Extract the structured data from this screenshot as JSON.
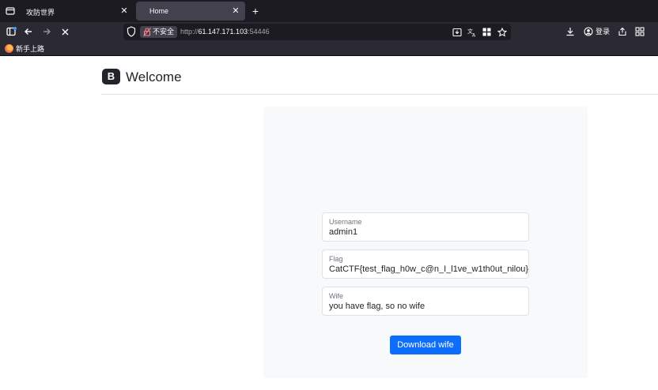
{
  "browser": {
    "tabs": [
      {
        "title": "攻防世界",
        "active": false
      },
      {
        "title": "Home",
        "active": true
      }
    ],
    "url": {
      "security_label": "不安全",
      "scheme": "http://",
      "host": "61.147.171.103",
      "port": ":54446"
    },
    "login_label": "登录",
    "bookmarks": [
      {
        "label": "新手上路"
      }
    ],
    "icons": [
      "tab-list-icon",
      "close-icon",
      "plus-icon",
      "sidebar-icon",
      "back-arrow-icon",
      "forward-arrow-icon",
      "stop-icon",
      "shield-icon",
      "lock-slash-icon",
      "save-page-icon",
      "translate-icon",
      "extensions-grid-icon",
      "star-icon",
      "download-icon",
      "account-icon",
      "share-icon",
      "apps-icon",
      "firefox-icon"
    ],
    "colors": {
      "tabbar": "#1c1b22",
      "toolbar": "#2b2a33",
      "active_tab": "#42414d"
    }
  },
  "page": {
    "brand_letter": "B",
    "title": "Welcome",
    "form": {
      "username_label": "Username",
      "username_value": "admin1",
      "flag_label": "Flag",
      "flag_value": "CatCTF{test_flag_h0w_c@n_I_l1ve_w1th0ut_nilou}",
      "wife_label": "Wife",
      "wife_value": "you have flag, so no wife",
      "download_label": "Download wife"
    },
    "colors": {
      "primary": "#0d6efd",
      "panel": "#f8f9fa",
      "text": "#212529"
    }
  }
}
